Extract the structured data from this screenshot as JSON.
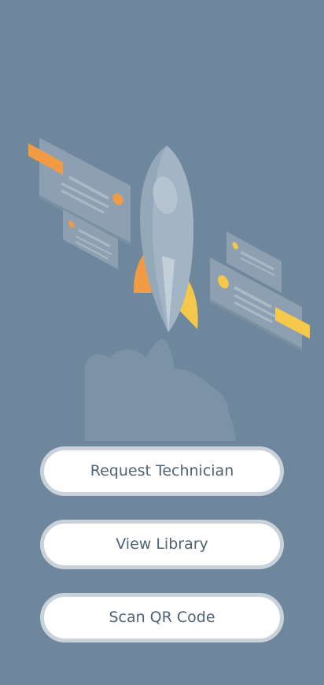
{
  "screen": {
    "background_color": "#6f879c"
  },
  "illustration": {
    "icon": "rocket-launch-illustration",
    "accent_orange": "#f29b45",
    "accent_yellow": "#f5c84c"
  },
  "actions": [
    {
      "id": "request-technician",
      "label": "Request Technician"
    },
    {
      "id": "view-library",
      "label": "View Library"
    },
    {
      "id": "scan-qr-code",
      "label": "Scan QR Code"
    }
  ]
}
